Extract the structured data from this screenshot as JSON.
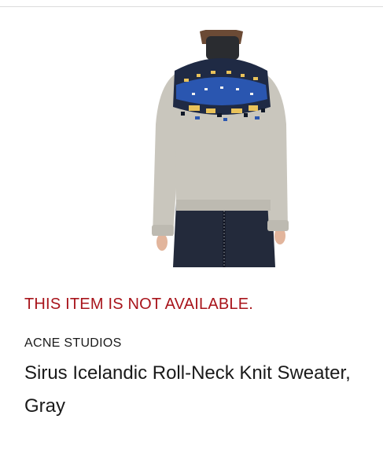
{
  "product": {
    "availability_text": "THIS ITEM IS NOT AVAILABLE.",
    "brand": "ACNE STUDIOS",
    "name": "Sirus Icelandic Roll-Neck Knit Sweater, Gray",
    "image_icon": "product-photo-sweater"
  },
  "colors": {
    "availability": "#a8141b",
    "text": "#1a1a1a",
    "sweater": "#c9c6bd",
    "skirt": "#232a3b"
  }
}
